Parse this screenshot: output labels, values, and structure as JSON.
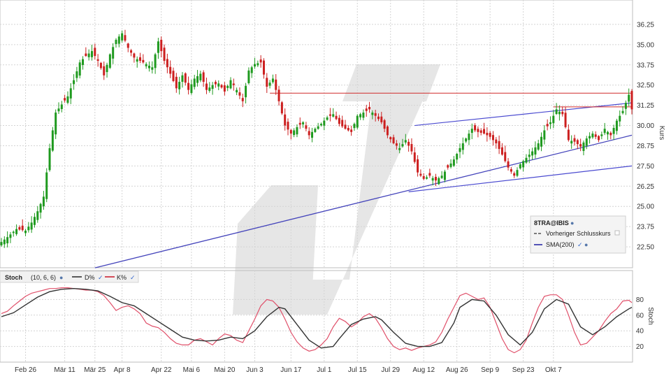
{
  "watermark": {
    "description": "large grey slanted parallelogram logo",
    "color": "#e6e6e6"
  },
  "price_panel": {
    "ylabel": "Kurs",
    "legend": {
      "title": "8TRA@IBIS",
      "items": [
        {
          "label": "Vorheriger Schlusskurs",
          "style": "dashed",
          "color": "#333333"
        },
        {
          "label": "SMA(200)",
          "style": "solid",
          "color": "#2a2aa6"
        }
      ]
    }
  },
  "stoch_panel": {
    "header": {
      "name": "Stoch",
      "params": "(10, 6, 6)",
      "d_label": "D%",
      "k_label": "K%"
    },
    "ylabel": "Stoch"
  },
  "colors": {
    "up": "#1f9a1f",
    "down": "#cc1f1f",
    "sma": "#4444bb",
    "channel": "#4a4ad0",
    "resistance": "#d02a2a",
    "k_line": "#e0506a",
    "d_line": "#333333",
    "grid": "#d4d4d4"
  },
  "chart_data": [
    {
      "type": "candlestick",
      "ylabel": "Kurs",
      "ylim": [
        21.25,
        37.5
      ],
      "yticks": [
        "22.50",
        "23.75",
        "25.00",
        "26.25",
        "27.50",
        "28.75",
        "30.00",
        "31.25",
        "32.50",
        "33.75",
        "35.00",
        "36.25"
      ],
      "x_tick_labels": [
        "Feb 26",
        "Mär 11",
        "Mär 25",
        "Apr 8",
        "Apr 22",
        "Mai 6",
        "Mai 20",
        "Jun 3",
        "Jun 17",
        "Jul 1",
        "Jul 15",
        "Jul 29",
        "Aug 12",
        "Aug 26",
        "Sep 9",
        "Sep 23",
        "Okt 7"
      ],
      "x_tick_index": [
        8,
        21,
        31,
        40,
        53,
        63,
        74,
        84,
        96,
        107,
        118,
        129,
        140,
        151,
        162,
        173,
        183
      ],
      "close_path": [
        [
          0,
          22.8
        ],
        [
          2,
          23.1
        ],
        [
          5,
          23.6
        ],
        [
          8,
          23.5
        ],
        [
          10,
          24.0
        ],
        [
          12,
          24.7
        ],
        [
          14,
          25.6
        ],
        [
          16,
          28.6
        ],
        [
          18,
          30.8
        ],
        [
          20,
          31.3
        ],
        [
          22,
          31.8
        ],
        [
          24,
          32.8
        ],
        [
          26,
          33.9
        ],
        [
          28,
          34.3
        ],
        [
          30,
          34.6
        ],
        [
          32,
          34.0
        ],
        [
          34,
          33.1
        ],
        [
          36,
          34.4
        ],
        [
          38,
          35.3
        ],
        [
          40,
          35.7
        ],
        [
          42,
          34.8
        ],
        [
          44,
          34.2
        ],
        [
          46,
          34.0
        ],
        [
          48,
          33.8
        ],
        [
          50,
          33.6
        ],
        [
          52,
          35.2
        ],
        [
          54,
          34.0
        ],
        [
          56,
          33.2
        ],
        [
          58,
          32.3
        ],
        [
          60,
          33.1
        ],
        [
          62,
          32.2
        ],
        [
          64,
          32.9
        ],
        [
          66,
          33.2
        ],
        [
          68,
          32.2
        ],
        [
          70,
          32.5
        ],
        [
          72,
          32.6
        ],
        [
          74,
          32.1
        ],
        [
          76,
          32.8
        ],
        [
          78,
          32.2
        ],
        [
          80,
          31.5
        ],
        [
          82,
          33.4
        ],
        [
          84,
          33.8
        ],
        [
          86,
          33.9
        ],
        [
          88,
          32.4
        ],
        [
          90,
          32.9
        ],
        [
          92,
          31.5
        ],
        [
          94,
          30.0
        ],
        [
          96,
          29.5
        ],
        [
          98,
          29.9
        ],
        [
          100,
          30.2
        ],
        [
          102,
          29.4
        ],
        [
          104,
          29.8
        ],
        [
          106,
          30.1
        ],
        [
          108,
          30.5
        ],
        [
          110,
          30.7
        ],
        [
          112,
          30.1
        ],
        [
          114,
          29.8
        ],
        [
          116,
          29.6
        ],
        [
          118,
          30.6
        ],
        [
          120,
          30.8
        ],
        [
          122,
          31.0
        ],
        [
          124,
          30.6
        ],
        [
          126,
          30.2
        ],
        [
          128,
          29.4
        ],
        [
          130,
          28.9
        ],
        [
          132,
          28.6
        ],
        [
          134,
          29.1
        ],
        [
          136,
          28.4
        ],
        [
          138,
          27.1
        ],
        [
          140,
          26.7
        ],
        [
          142,
          26.9
        ],
        [
          144,
          26.6
        ],
        [
          146,
          26.9
        ],
        [
          148,
          27.4
        ],
        [
          150,
          27.9
        ],
        [
          152,
          28.6
        ],
        [
          154,
          29.2
        ],
        [
          156,
          29.8
        ],
        [
          158,
          29.6
        ],
        [
          160,
          29.5
        ],
        [
          162,
          29.3
        ],
        [
          164,
          28.9
        ],
        [
          166,
          28.2
        ],
        [
          168,
          27.4
        ],
        [
          170,
          26.9
        ],
        [
          172,
          27.6
        ],
        [
          174,
          28.0
        ],
        [
          176,
          28.4
        ],
        [
          178,
          28.9
        ],
        [
          180,
          29.7
        ],
        [
          182,
          30.2
        ],
        [
          184,
          31.0
        ],
        [
          186,
          30.7
        ],
        [
          188,
          29.1
        ],
        [
          190,
          29.0
        ],
        [
          192,
          28.7
        ],
        [
          194,
          29.2
        ],
        [
          196,
          29.5
        ],
        [
          198,
          29.1
        ],
        [
          200,
          29.8
        ],
        [
          202,
          29.4
        ],
        [
          204,
          30.3
        ],
        [
          206,
          30.9
        ],
        [
          208,
          31.9
        ],
        [
          209,
          31.0
        ]
      ],
      "sma200": {
        "from": [
          31,
          21.2
        ],
        "to": [
          209,
          29.4
        ]
      },
      "channel_upper": {
        "from": [
          137,
          30.0
        ],
        "to": [
          209,
          31.4
        ]
      },
      "channel_lower": {
        "from": [
          135,
          25.9
        ],
        "to": [
          209,
          27.5
        ]
      },
      "resistance": {
        "from": [
          89,
          32.0
        ],
        "to": [
          209,
          32.0
        ]
      },
      "prev_close": {
        "from": [
          183,
          31.15
        ],
        "to": [
          209,
          31.15
        ]
      }
    },
    {
      "type": "line",
      "ylabel": "Stoch",
      "ylim": [
        0,
        100
      ],
      "yticks": [
        "20",
        "40",
        "60",
        "80"
      ],
      "series": [
        {
          "name": "K%",
          "values_path": [
            [
              0,
              62
            ],
            [
              2,
              65
            ],
            [
              4,
              72
            ],
            [
              6,
              78
            ],
            [
              8,
              84
            ],
            [
              10,
              88
            ],
            [
              12,
              90
            ],
            [
              14,
              92
            ],
            [
              16,
              94
            ],
            [
              18,
              94
            ],
            [
              20,
              95
            ],
            [
              22,
              95
            ],
            [
              24,
              94
            ],
            [
              26,
              93
            ],
            [
              28,
              92
            ],
            [
              30,
              92
            ],
            [
              32,
              90
            ],
            [
              34,
              85
            ],
            [
              36,
              76
            ],
            [
              38,
              66
            ],
            [
              40,
              70
            ],
            [
              42,
              72
            ],
            [
              44,
              68
            ],
            [
              46,
              62
            ],
            [
              48,
              50
            ],
            [
              50,
              46
            ],
            [
              52,
              44
            ],
            [
              54,
              38
            ],
            [
              56,
              30
            ],
            [
              58,
              24
            ],
            [
              60,
              22
            ],
            [
              62,
              22
            ],
            [
              64,
              28
            ],
            [
              66,
              30
            ],
            [
              68,
              26
            ],
            [
              70,
              22
            ],
            [
              72,
              30
            ],
            [
              74,
              36
            ],
            [
              76,
              34
            ],
            [
              78,
              28
            ],
            [
              80,
              25
            ],
            [
              82,
              40
            ],
            [
              84,
              55
            ],
            [
              86,
              72
            ],
            [
              88,
              80
            ],
            [
              90,
              78
            ],
            [
              92,
              70
            ],
            [
              94,
              55
            ],
            [
              96,
              38
            ],
            [
              98,
              26
            ],
            [
              100,
              18
            ],
            [
              102,
              14
            ],
            [
              104,
              16
            ],
            [
              106,
              22
            ],
            [
              108,
              30
            ],
            [
              110,
              45
            ],
            [
              112,
              56
            ],
            [
              114,
              52
            ],
            [
              116,
              45
            ],
            [
              118,
              50
            ],
            [
              120,
              58
            ],
            [
              122,
              62
            ],
            [
              124,
              56
            ],
            [
              126,
              44
            ],
            [
              128,
              30
            ],
            [
              130,
              20
            ],
            [
              132,
              16
            ],
            [
              134,
              18
            ],
            [
              136,
              15
            ],
            [
              138,
              18
            ],
            [
              140,
              20
            ],
            [
              142,
              22
            ],
            [
              144,
              26
            ],
            [
              146,
              38
            ],
            [
              148,
              55
            ],
            [
              150,
              70
            ],
            [
              152,
              85
            ],
            [
              154,
              88
            ],
            [
              156,
              84
            ],
            [
              158,
              80
            ],
            [
              160,
              82
            ],
            [
              162,
              70
            ],
            [
              164,
              50
            ],
            [
              166,
              30
            ],
            [
              168,
              16
            ],
            [
              170,
              12
            ],
            [
              172,
              16
            ],
            [
              174,
              28
            ],
            [
              176,
              50
            ],
            [
              178,
              70
            ],
            [
              180,
              84
            ],
            [
              182,
              86
            ],
            [
              184,
              86
            ],
            [
              186,
              80
            ],
            [
              188,
              60
            ],
            [
              190,
              38
            ],
            [
              192,
              22
            ],
            [
              194,
              24
            ],
            [
              196,
              32
            ],
            [
              198,
              40
            ],
            [
              200,
              52
            ],
            [
              202,
              62
            ],
            [
              204,
              68
            ],
            [
              206,
              78
            ],
            [
              208,
              79
            ],
            [
              209,
              76
            ]
          ]
        },
        {
          "name": "D%",
          "values_path": [
            [
              0,
              58
            ],
            [
              4,
              63
            ],
            [
              8,
              73
            ],
            [
              12,
              83
            ],
            [
              16,
              90
            ],
            [
              20,
              93
            ],
            [
              24,
              94
            ],
            [
              28,
              93
            ],
            [
              32,
              91
            ],
            [
              36,
              84
            ],
            [
              40,
              76
            ],
            [
              44,
              72
            ],
            [
              48,
              62
            ],
            [
              52,
              52
            ],
            [
              56,
              42
            ],
            [
              60,
              32
            ],
            [
              64,
              28
            ],
            [
              68,
              27
            ],
            [
              72,
              28
            ],
            [
              76,
              32
            ],
            [
              80,
              30
            ],
            [
              84,
              40
            ],
            [
              88,
              58
            ],
            [
              92,
              70
            ],
            [
              94,
              68
            ],
            [
              98,
              48
            ],
            [
              102,
              28
            ],
            [
              106,
              18
            ],
            [
              110,
              20
            ],
            [
              112,
              30
            ],
            [
              116,
              48
            ],
            [
              120,
              55
            ],
            [
              124,
              58
            ],
            [
              126,
              54
            ],
            [
              130,
              38
            ],
            [
              134,
              24
            ],
            [
              138,
              20
            ],
            [
              142,
              20
            ],
            [
              146,
              25
            ],
            [
              150,
              50
            ],
            [
              152,
              70
            ],
            [
              156,
              80
            ],
            [
              160,
              78
            ],
            [
              164,
              60
            ],
            [
              168,
              35
            ],
            [
              172,
              22
            ],
            [
              176,
              38
            ],
            [
              180,
              68
            ],
            [
              184,
              80
            ],
            [
              188,
              74
            ],
            [
              192,
              45
            ],
            [
              196,
              35
            ],
            [
              200,
              45
            ],
            [
              204,
              58
            ],
            [
              208,
              68
            ],
            [
              209,
              70
            ]
          ]
        }
      ]
    }
  ]
}
